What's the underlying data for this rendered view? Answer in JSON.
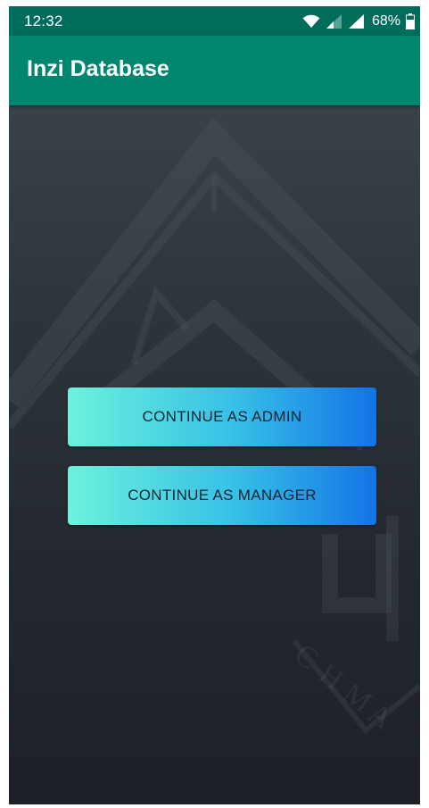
{
  "status_bar": {
    "time": "12:32",
    "battery_percent": "68%"
  },
  "app_bar": {
    "title": "Inzi Database"
  },
  "actions": {
    "admin_label": "CONTINUE AS ADMIN",
    "manager_label": "CONTINUE AS MANAGER"
  },
  "colors": {
    "status_bar": "#006d5c",
    "app_bar": "#00866f",
    "button_gradient_start": "#6cf2dc",
    "button_gradient_end": "#1473e6",
    "button_text": "#1b2430"
  },
  "icons": [
    "wifi-icon",
    "signal-icon",
    "battery-icon"
  ]
}
